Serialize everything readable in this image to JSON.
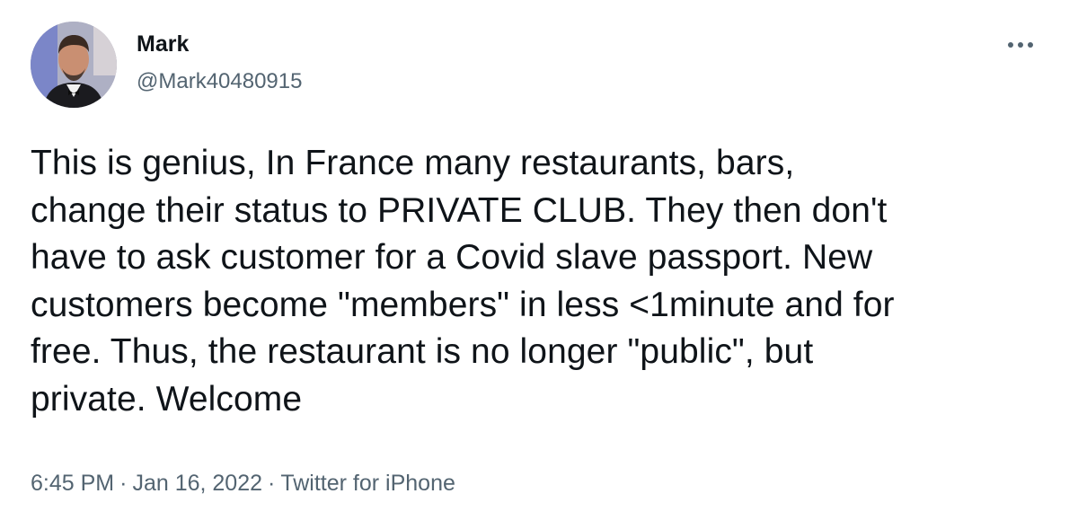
{
  "author": {
    "display_name": "Mark",
    "handle": "@Mark40480915",
    "avatar_icon": "profile-photo"
  },
  "more_icon": "more-horizontal-icon",
  "tweet": {
    "lines": [
      "This is genius, In France many restaurants, bars,",
      "change their status to PRIVATE CLUB. They then don't",
      "have to ask customer for a Covid slave passport. New",
      "customers become \"members\" in less <1minute and for",
      "free. Thus, the restaurant is no longer \"public\", but",
      "private. Welcome"
    ]
  },
  "meta": {
    "time": "6:45 PM",
    "date": "Jan 16, 2022",
    "source": "Twitter for iPhone",
    "separator": "·"
  },
  "colors": {
    "text_primary": "#0f1419",
    "text_secondary": "#536471",
    "background": "#ffffff"
  }
}
